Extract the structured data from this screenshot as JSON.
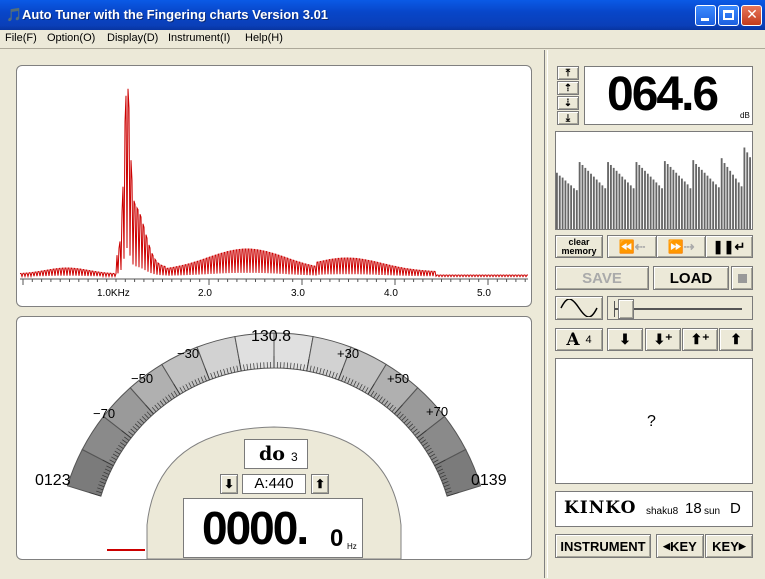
{
  "window": {
    "title": "Auto Tuner with the Fingering charts  Version 3.01"
  },
  "menu": [
    "File(F)",
    "Option(O)",
    "Display(D)",
    "Instrument(I)",
    "Help(H)"
  ],
  "spectrum": {
    "x_ticks": [
      "1.0KHz",
      "2.0",
      "3.0",
      "4.0",
      "5.0"
    ],
    "color": "#cc0000"
  },
  "meter": {
    "center_freq": "130.8",
    "left_freq": "0123",
    "right_freq": "0139",
    "cents": [
      "−70",
      "−50",
      "−30",
      "+30",
      "+50",
      "+70"
    ],
    "note_name": "do",
    "octave": "3",
    "reference": "A:440",
    "freq_main": "0000.",
    "freq_decimal": "0",
    "freq_unit": "Hz"
  },
  "level": {
    "value": "064.6",
    "unit": "dB",
    "history_fraction": [
      0.58,
      0.55,
      0.53,
      0.5,
      0.47,
      0.45,
      0.42,
      0.4,
      0.69,
      0.66,
      0.63,
      0.6,
      0.57,
      0.54,
      0.51,
      0.48,
      0.45,
      0.42,
      0.69,
      0.66,
      0.63,
      0.6,
      0.57,
      0.54,
      0.51,
      0.48,
      0.45,
      0.42,
      0.69,
      0.66,
      0.63,
      0.6,
      0.57,
      0.54,
      0.51,
      0.48,
      0.45,
      0.42,
      0.7,
      0.67,
      0.64,
      0.61,
      0.58,
      0.55,
      0.52,
      0.49,
      0.46,
      0.42,
      0.71,
      0.67,
      0.64,
      0.61,
      0.58,
      0.55,
      0.52,
      0.49,
      0.46,
      0.43,
      0.73,
      0.68,
      0.64,
      0.6,
      0.56,
      0.52,
      0.48,
      0.44,
      0.84,
      0.79,
      0.74
    ]
  },
  "controls": {
    "clear_memory_1": "clear",
    "clear_memory_2": "memory",
    "save": "SAVE",
    "load": "LOAD",
    "a_octave": "4",
    "question": "?",
    "instrument_brand": "KINKO",
    "instrument_type": "shaku8",
    "instrument_size": "18",
    "instrument_size_unit": "sun",
    "instrument_key": "D",
    "instrument_button": "INSTRUMENT",
    "key_down": "KEY",
    "key_up": "KEY"
  }
}
